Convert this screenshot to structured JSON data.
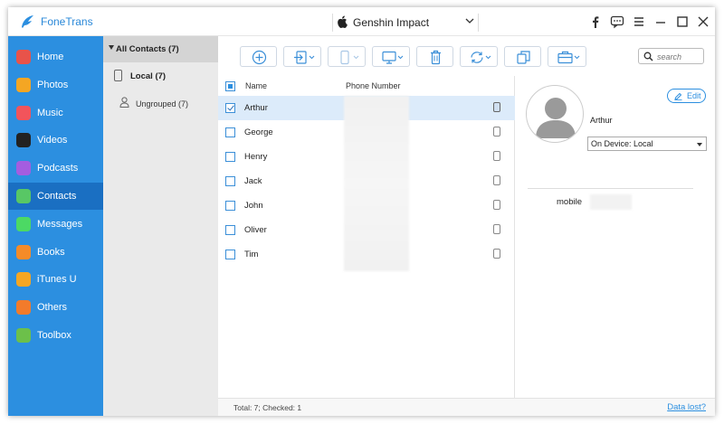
{
  "app": {
    "name": "FoneTrans",
    "accent": "#2c8fe0"
  },
  "device": {
    "name": "Genshin Impact"
  },
  "titlebar_icons": [
    "facebook-icon",
    "feedback-icon",
    "menu-icon",
    "minimize-icon",
    "maximize-icon",
    "close-icon"
  ],
  "sidebar": {
    "items": [
      {
        "label": "Home",
        "icon": "home-icon",
        "color": "#e8534a"
      },
      {
        "label": "Photos",
        "icon": "photos-icon",
        "color": "#f4a623"
      },
      {
        "label": "Music",
        "icon": "music-icon",
        "color": "#f2545b"
      },
      {
        "label": "Videos",
        "icon": "videos-icon",
        "color": "#222222"
      },
      {
        "label": "Podcasts",
        "icon": "podcasts-icon",
        "color": "#a45de0"
      },
      {
        "label": "Contacts",
        "icon": "contacts-icon",
        "color": "#58c765"
      },
      {
        "label": "Messages",
        "icon": "messages-icon",
        "color": "#4cd964"
      },
      {
        "label": "Books",
        "icon": "books-icon",
        "color": "#f58b28"
      },
      {
        "label": "iTunes U",
        "icon": "itunes-u-icon",
        "color": "#f5a623"
      },
      {
        "label": "Others",
        "icon": "others-icon",
        "color": "#f27b2b"
      },
      {
        "label": "Toolbox",
        "icon": "toolbox-icon",
        "color": "#6cc04a"
      }
    ],
    "active_index": 5
  },
  "groups": {
    "all": "All Contacts  (7)",
    "local": "Local  (7)",
    "ungrouped": "Ungrouped  (7)"
  },
  "toolbar": {
    "buttons": [
      "add-icon",
      "import-icon",
      "export-to-device-icon",
      "export-to-pc-icon",
      "delete-icon",
      "sync-icon",
      "duplicate-icon",
      "toolbox-briefcase-icon"
    ],
    "search_placeholder": "search"
  },
  "list": {
    "col_name": "Name",
    "col_phone": "Phone Number",
    "rows": [
      {
        "name": "Arthur",
        "checked": true
      },
      {
        "name": "George",
        "checked": false
      },
      {
        "name": "Henry",
        "checked": false
      },
      {
        "name": "Jack",
        "checked": false
      },
      {
        "name": "John",
        "checked": false
      },
      {
        "name": "Oliver",
        "checked": false
      },
      {
        "name": "Tim",
        "checked": false
      }
    ]
  },
  "detail": {
    "edit_label": "Edit",
    "name": "Arthur",
    "storage": "On Device: Local",
    "field_label": "mobile"
  },
  "status": {
    "summary": "Total: 7; Checked: 1",
    "link": "Data lost?"
  }
}
